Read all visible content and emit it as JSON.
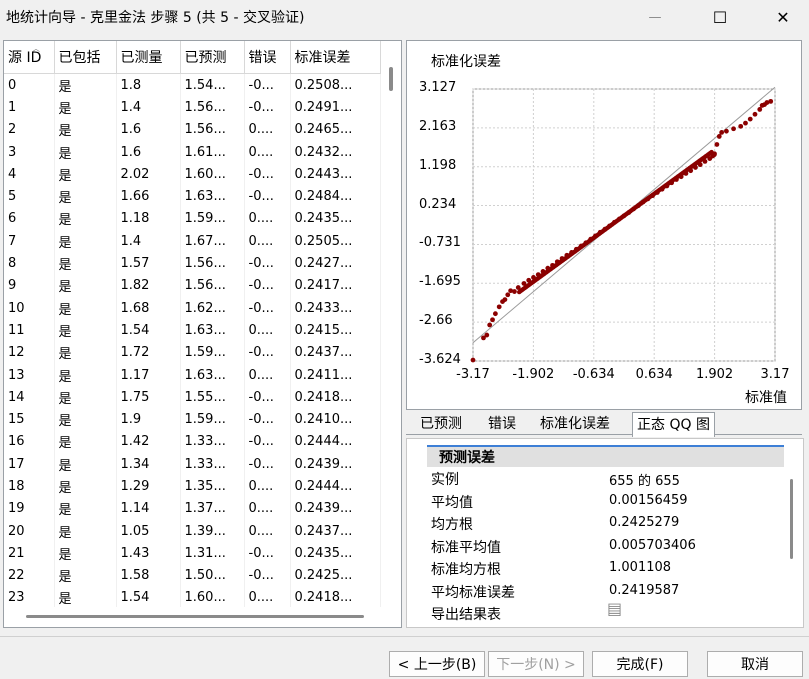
{
  "window": {
    "title": "地统计向导 - 克里金法 步骤 5 (共 5 - 交叉验证)",
    "minimize_glyph": "—",
    "maximize_glyph": "☐",
    "close_glyph": "✕"
  },
  "table": {
    "columns": [
      "源 ID",
      "已包括",
      "已测量",
      "已预测",
      "错误",
      "标准误差"
    ],
    "rows": [
      [
        "0",
        "是",
        "1.8",
        "1.54...",
        "-0...",
        "0.2508..."
      ],
      [
        "1",
        "是",
        "1.4",
        "1.56...",
        "-0...",
        "0.2491..."
      ],
      [
        "2",
        "是",
        "1.6",
        "1.56...",
        "0....",
        "0.2465..."
      ],
      [
        "3",
        "是",
        "1.6",
        "1.61...",
        "0....",
        "0.2432..."
      ],
      [
        "4",
        "是",
        "2.02",
        "1.60...",
        "-0...",
        "0.2443..."
      ],
      [
        "5",
        "是",
        "1.66",
        "1.63...",
        "-0...",
        "0.2484..."
      ],
      [
        "6",
        "是",
        "1.18",
        "1.59...",
        "0....",
        "0.2435..."
      ],
      [
        "7",
        "是",
        "1.4",
        "1.67...",
        "0....",
        "0.2505..."
      ],
      [
        "8",
        "是",
        "1.57",
        "1.56...",
        "-0...",
        "0.2427..."
      ],
      [
        "9",
        "是",
        "1.82",
        "1.56...",
        "-0...",
        "0.2417..."
      ],
      [
        "10",
        "是",
        "1.68",
        "1.62...",
        "-0...",
        "0.2433..."
      ],
      [
        "11",
        "是",
        "1.54",
        "1.63...",
        "0....",
        "0.2415..."
      ],
      [
        "12",
        "是",
        "1.72",
        "1.59...",
        "-0...",
        "0.2437..."
      ],
      [
        "13",
        "是",
        "1.17",
        "1.63...",
        "0....",
        "0.2411..."
      ],
      [
        "14",
        "是",
        "1.75",
        "1.55...",
        "-0...",
        "0.2418..."
      ],
      [
        "15",
        "是",
        "1.9",
        "1.59...",
        "-0...",
        "0.2410..."
      ],
      [
        "16",
        "是",
        "1.42",
        "1.33...",
        "-0...",
        "0.2444..."
      ],
      [
        "17",
        "是",
        "1.34",
        "1.33...",
        "-0...",
        "0.2439..."
      ],
      [
        "18",
        "是",
        "1.29",
        "1.35...",
        "0....",
        "0.2444..."
      ],
      [
        "19",
        "是",
        "1.14",
        "1.37...",
        "0....",
        "0.2439..."
      ],
      [
        "20",
        "是",
        "1.05",
        "1.39...",
        "0....",
        "0.2437..."
      ],
      [
        "21",
        "是",
        "1.43",
        "1.31...",
        "-0...",
        "0.2435..."
      ],
      [
        "22",
        "是",
        "1.58",
        "1.50...",
        "-0...",
        "0.2425..."
      ],
      [
        "23",
        "是",
        "1.54",
        "1.60...",
        "0....",
        "0.2418..."
      ]
    ]
  },
  "chart_data": {
    "type": "scatter",
    "title": "标准化误差",
    "xlabel": "标准值",
    "ylabel": "标准化误差",
    "x_ticks": [
      "-3.17",
      "-1.902",
      "-0.634",
      "0.634",
      "1.902",
      "3.17"
    ],
    "y_ticks": [
      "3.127",
      "2.163",
      "1.198",
      "0.234",
      "-0.731",
      "-1.695",
      "-2.66",
      "-3.624"
    ],
    "xlim": [
      -3.17,
      3.17
    ],
    "ylim": [
      -3.624,
      3.127
    ],
    "grid": true,
    "reference_line": [
      [
        -3.17,
        -3.17
      ],
      [
        3.17,
        3.17
      ]
    ],
    "point_color": "#8b0000",
    "points": [
      [
        -3.17,
        -3.6
      ],
      [
        -2.95,
        -3.05
      ],
      [
        -2.88,
        -2.98
      ],
      [
        -2.82,
        -2.73
      ],
      [
        -2.76,
        -2.6
      ],
      [
        -2.7,
        -2.45
      ],
      [
        -2.62,
        -2.28
      ],
      [
        -2.55,
        -2.15
      ],
      [
        -2.5,
        -2.1
      ],
      [
        -2.44,
        -1.98
      ],
      [
        -2.38,
        -1.88
      ],
      [
        -2.3,
        -1.9
      ],
      [
        -2.22,
        -1.8
      ],
      [
        -2.1,
        -1.7
      ],
      [
        -2.0,
        -1.62
      ],
      [
        -1.9,
        -1.55
      ],
      [
        -1.8,
        -1.48
      ],
      [
        -1.7,
        -1.4
      ],
      [
        -1.6,
        -1.32
      ],
      [
        -1.5,
        -1.25
      ],
      [
        -1.4,
        -1.16
      ],
      [
        -1.3,
        -1.08
      ],
      [
        -1.2,
        -1.0
      ],
      [
        -1.1,
        -0.93
      ],
      [
        -1.0,
        -0.85
      ],
      [
        -0.9,
        -0.77
      ],
      [
        -0.8,
        -0.69
      ],
      [
        -0.7,
        -0.6
      ],
      [
        -0.6,
        -0.52
      ],
      [
        -0.5,
        -0.43
      ],
      [
        -0.4,
        -0.35
      ],
      [
        -0.3,
        -0.27
      ],
      [
        -0.2,
        -0.18
      ],
      [
        -0.1,
        -0.1
      ],
      [
        0.0,
        -0.02
      ],
      [
        0.1,
        0.06
      ],
      [
        0.2,
        0.15
      ],
      [
        0.3,
        0.23
      ],
      [
        0.4,
        0.32
      ],
      [
        0.5,
        0.4
      ],
      [
        0.6,
        0.48
      ],
      [
        0.7,
        0.56
      ],
      [
        0.8,
        0.64
      ],
      [
        0.9,
        0.72
      ],
      [
        1.0,
        0.8
      ],
      [
        1.1,
        0.88
      ],
      [
        1.2,
        0.95
      ],
      [
        1.3,
        1.03
      ],
      [
        1.4,
        1.1
      ],
      [
        1.5,
        1.18
      ],
      [
        1.6,
        1.25
      ],
      [
        1.7,
        1.33
      ],
      [
        1.8,
        1.4
      ],
      [
        1.9,
        1.52
      ],
      [
        1.95,
        1.75
      ],
      [
        2.0,
        1.95
      ],
      [
        2.05,
        2.05
      ],
      [
        2.15,
        2.08
      ],
      [
        2.3,
        2.14
      ],
      [
        2.45,
        2.2
      ],
      [
        2.55,
        2.28
      ],
      [
        2.65,
        2.38
      ],
      [
        2.75,
        2.5
      ],
      [
        2.85,
        2.62
      ],
      [
        2.9,
        2.72
      ],
      [
        2.95,
        2.74
      ],
      [
        3.0,
        2.79
      ],
      [
        3.08,
        2.82
      ]
    ]
  },
  "tabs": [
    "已预测",
    "错误",
    "标准化误差",
    "正态 QQ 图"
  ],
  "active_tab": "正态 QQ 图",
  "stats": {
    "header": "预测误差",
    "rows": [
      {
        "label": "实例",
        "value": "655 的 655"
      },
      {
        "label": "平均值",
        "value": "0.00156459"
      },
      {
        "label": "均方根",
        "value": "0.2425279"
      },
      {
        "label": "标准平均值",
        "value": "0.005703406"
      },
      {
        "label": "标准均方根",
        "value": "1.001108"
      },
      {
        "label": "平均标准误差",
        "value": "0.2419587"
      },
      {
        "label": "导出结果表",
        "value": ""
      }
    ]
  },
  "buttons": {
    "back": "< 上一步(B)",
    "next": "下一步(N) >",
    "finish": "完成(F)",
    "cancel": "取消"
  }
}
